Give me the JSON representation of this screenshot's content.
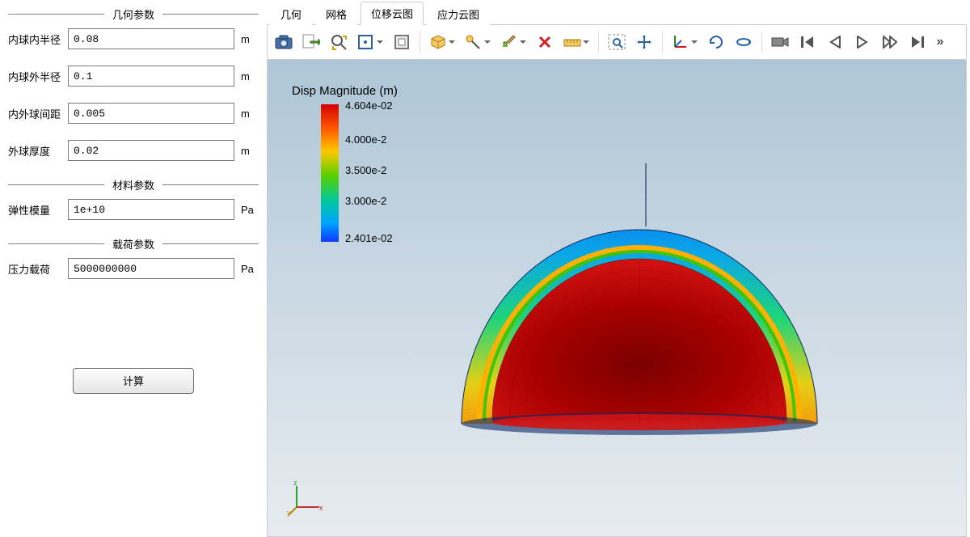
{
  "panel": {
    "groups": {
      "geometry": {
        "title": "几何参数"
      },
      "material": {
        "title": "材料参数"
      },
      "load": {
        "title": "载荷参数"
      }
    },
    "fields": {
      "inner_radius_in": {
        "label": "内球内半径",
        "value": "0.08",
        "unit": "m"
      },
      "inner_radius_out": {
        "label": "内球外半径",
        "value": "0.1",
        "unit": "m"
      },
      "gap": {
        "label": "内外球间距",
        "value": "0.005",
        "unit": "m"
      },
      "outer_thickness": {
        "label": "外球厚度",
        "value": "0.02",
        "unit": "m"
      },
      "elastic_modulus": {
        "label": "弹性模量",
        "value": "1e+10",
        "unit": "Pa"
      },
      "pressure_load": {
        "label": "压力载荷",
        "value": "5000000000",
        "unit": "Pa"
      }
    },
    "calc_button": "计算"
  },
  "tabs": {
    "geometry": "几何",
    "mesh": "网格",
    "disp": "位移云图",
    "stress": "应力云图",
    "active": "disp"
  },
  "toolbar_icons": {
    "screenshot": "screenshot-icon",
    "export": "export-icon",
    "zoom": "zoom-icon",
    "fit": "fit-view-icon",
    "frame": "frame-icon",
    "box": "box-select-icon",
    "probe": "probe-icon",
    "brush": "brush-icon",
    "delete": "delete-icon",
    "ruler": "ruler-icon",
    "zoom_area": "zoom-area-icon",
    "pan": "pan-icon",
    "axes": "axes-icon",
    "rotate": "rotate-icon",
    "spin": "spin-icon",
    "camera": "camera-icon",
    "first": "first-frame-icon",
    "prev": "prev-frame-icon",
    "play": "play-icon",
    "next": "next-frame-icon",
    "last": "last-frame-icon",
    "more": "»"
  },
  "legend": {
    "title": "Disp Magnitude (m)",
    "ticks": [
      {
        "value": "4.604e-02",
        "pos": 0
      },
      {
        "value": "4.000e-2",
        "pos": 24
      },
      {
        "value": "3.500e-2",
        "pos": 47
      },
      {
        "value": "3.000e-2",
        "pos": 69
      },
      {
        "value": "2.401e-02",
        "pos": 96
      }
    ]
  },
  "colors": {
    "accent": "#3a77b7"
  }
}
